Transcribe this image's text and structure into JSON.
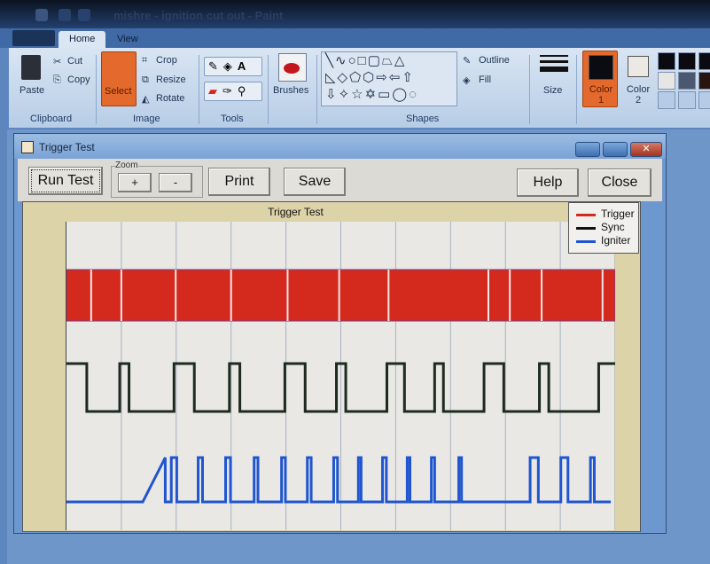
{
  "paint": {
    "title": "mishre - ignition cut out - Paint",
    "tabs": [
      "Home",
      "View"
    ],
    "clipboard": {
      "paste": "Paste",
      "cut": "Cut",
      "copy": "Copy",
      "group": "Clipboard"
    },
    "image": {
      "select": "Select",
      "crop": "Crop",
      "resize": "Resize",
      "rotate": "Rotate",
      "group": "Image"
    },
    "tools": {
      "group": "Tools"
    },
    "brushes": "Brushes",
    "shapes": {
      "outline": "Outline",
      "fill": "Fill",
      "group": "Shapes"
    },
    "size": "Size",
    "color1": "Color 1",
    "color2": "Color 2",
    "colors": {
      "color1": "#0b0b12",
      "color2": "#ece8e4"
    }
  },
  "window": {
    "title": "Trigger Test",
    "buttons": {
      "run": "Run Test",
      "zoom_label": "Zoom",
      "zoom_in": "+",
      "zoom_out": "-",
      "print": "Print",
      "save": "Save",
      "help": "Help",
      "close": "Close"
    }
  },
  "chart_data": {
    "type": "line",
    "title": "Trigger Test",
    "xlabel": "",
    "ylabel": "",
    "grid": true,
    "xlim": [
      0,
      10
    ],
    "legend_position": "top-right",
    "series": [
      {
        "name": "Trigger",
        "color": "#d42a1e",
        "kind": "dense-pulse-band",
        "gaps": [
          0.45,
          1.0,
          1.99,
          3.0,
          4.03,
          4.97,
          5.87,
          7.69,
          8.08,
          8.66,
          9.77
        ]
      },
      {
        "name": "Sync",
        "color": "#1d2a1e",
        "kind": "square",
        "initial": "high",
        "transitions": [
          0.37,
          0.97,
          1.14,
          1.96,
          2.33,
          2.97,
          3.16,
          3.98,
          4.35,
          4.92,
          5.09,
          5.84,
          6.16,
          6.71,
          6.87,
          7.61,
          7.97,
          8.62,
          8.79,
          9.7
        ]
      },
      {
        "name": "Igniter",
        "color": "#1f55d0",
        "kind": "pulses",
        "ramp": [
          1.39,
          1.8
        ],
        "ramp_fall": 1.83,
        "pulses": [
          [
            1.91,
            2.01
          ],
          [
            2.4,
            2.48
          ],
          [
            2.9,
            2.99
          ],
          [
            3.42,
            3.49
          ],
          [
            3.92,
            3.99
          ],
          [
            4.39,
            4.46
          ],
          [
            4.87,
            4.94
          ],
          [
            5.32,
            5.37
          ],
          [
            5.76,
            5.83
          ],
          [
            6.21,
            6.26
          ],
          [
            6.65,
            6.71
          ],
          [
            7.15,
            7.2
          ],
          [
            8.45,
            8.6
          ],
          [
            9.01,
            9.14
          ],
          [
            9.55,
            9.62
          ]
        ],
        "end": 9.92
      }
    ]
  }
}
